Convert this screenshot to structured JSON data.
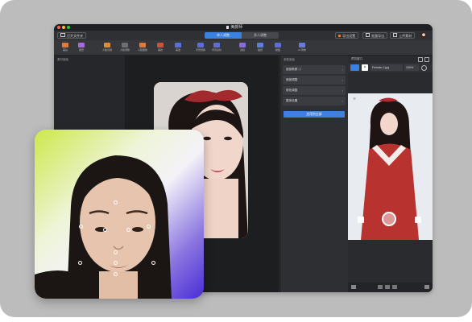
{
  "app": {
    "title": "美颜师",
    "header_icon": "document-icon"
  },
  "toolbar": {
    "open_folder": "打开文件夹",
    "tabs": [
      "单人调整",
      "多人调整"
    ],
    "tab_selected": "单人调整",
    "actions": [
      "导出设置",
      "批量导出",
      "上传素材"
    ]
  },
  "tools": [
    {
      "label": "美白",
      "icon": "orange-circle-icon",
      "color": "#e07a3a"
    },
    {
      "label": "磨皮",
      "icon": "purple-square-icon",
      "color": "#a46bdc"
    },
    {
      "label": "人脸识别",
      "icon": "orange-face-icon",
      "color": "#e08a3a"
    },
    {
      "label": "人脸调整",
      "icon": "grid-icon",
      "color": "#6d6e74"
    },
    {
      "label": "人脸瘦脸",
      "icon": "orange-face-icon",
      "color": "#e07a3a"
    },
    {
      "label": "美妆",
      "icon": "red-face-icon",
      "color": "#c7543d"
    },
    {
      "label": "美发",
      "icon": "blue-face-icon",
      "color": "#5a6fd8"
    },
    {
      "label": "背景替换",
      "icon": "frame-icon",
      "color": "#5b6ed6"
    },
    {
      "label": "背景虚化",
      "icon": "layers-icon",
      "color": "#5b6ed6"
    },
    {
      "label": "滤镜",
      "icon": "purple-square-icon",
      "color": "#8a6bd8"
    },
    {
      "label": "贴纸",
      "icon": "blue-square-icon",
      "color": "#5b7fd8"
    },
    {
      "label": "模板",
      "icon": "grid-icon",
      "color": "#5b6ed6"
    },
    {
      "label": "AI 特效",
      "icon": "sparkle-icon",
      "color": "#6b7ad8"
    }
  ],
  "left_panel": {
    "title": "素材面板"
  },
  "right_panel": {
    "title": "参数面板",
    "sections": [
      "面部美颜 ⓘ",
      "面部调整",
      "肤色调整",
      "整体设置"
    ],
    "apply_label": "应用到全部"
  },
  "preview": {
    "title": "预览窗口",
    "file_select": "Female-1.jpg",
    "zoom": "100%"
  },
  "colors": {
    "accent": "#3b82e0",
    "window_bg": "#2b2c2f",
    "card_bg": "#bcbcbc"
  }
}
